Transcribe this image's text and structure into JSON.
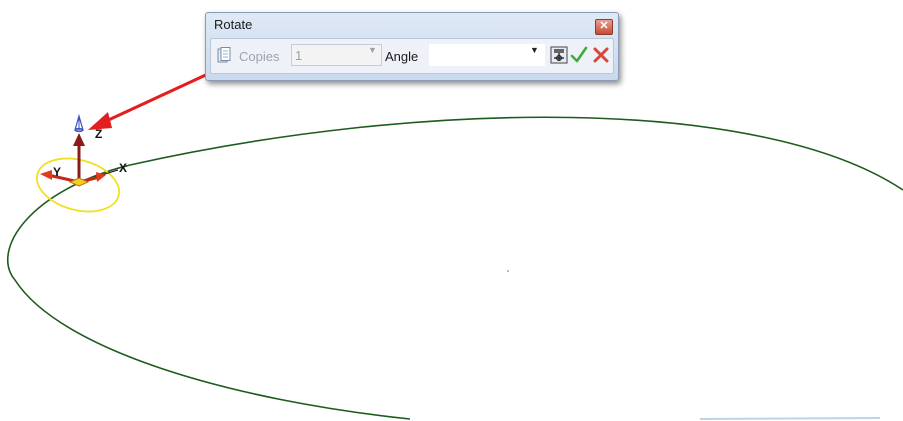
{
  "dialog": {
    "title": "Rotate",
    "close_glyph": "✕",
    "copies": {
      "label": "Copies",
      "value": "1",
      "enabled": false
    },
    "angle": {
      "label": "Angle",
      "value": ""
    },
    "buttons": [
      {
        "name": "options-icon"
      },
      {
        "name": "apply-check-icon"
      },
      {
        "name": "cancel-x-icon"
      }
    ]
  },
  "axes": {
    "x": "X",
    "y": "Y",
    "z": "Z"
  },
  "colors": {
    "curve": "#1e5b1e",
    "arrow": "#e31e1e",
    "highlight": "#f0e020",
    "axis": "#8b1a1a",
    "z_arrow": "#3a4fbf"
  }
}
